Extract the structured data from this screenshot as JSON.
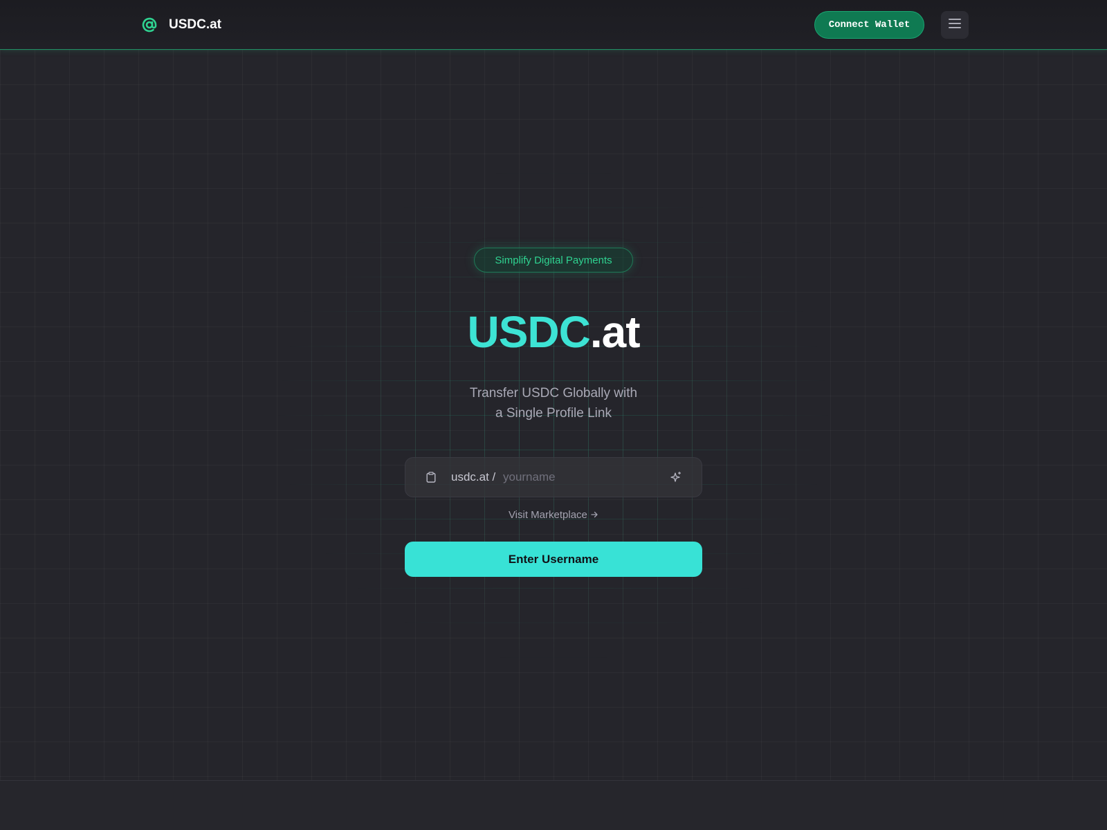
{
  "header": {
    "brand_name": "USDC.at",
    "connect_label": "Connect Wallet"
  },
  "hero": {
    "badge": "Simplify Digital Payments",
    "title_primary": "USDC",
    "title_secondary": ".at",
    "subtitle_line1": "Transfer USDC Globally with",
    "subtitle_line2": "a Single Profile Link"
  },
  "input": {
    "prefix": "usdc.at / ",
    "value": "",
    "placeholder": "yourname"
  },
  "marketplace_link": "Visit Marketplace",
  "enter_button": "Enter Username",
  "icons": {
    "brand": "at-sign-icon",
    "menu": "hamburger-menu-icon",
    "clipboard": "clipboard-icon",
    "sparkle": "sparkle-icon",
    "arrow": "arrow-right-icon"
  },
  "colors": {
    "accent_cyan": "#38e2d6",
    "accent_green": "#2fd391",
    "wallet_button": "#0f7a52",
    "background": "#25252b"
  }
}
